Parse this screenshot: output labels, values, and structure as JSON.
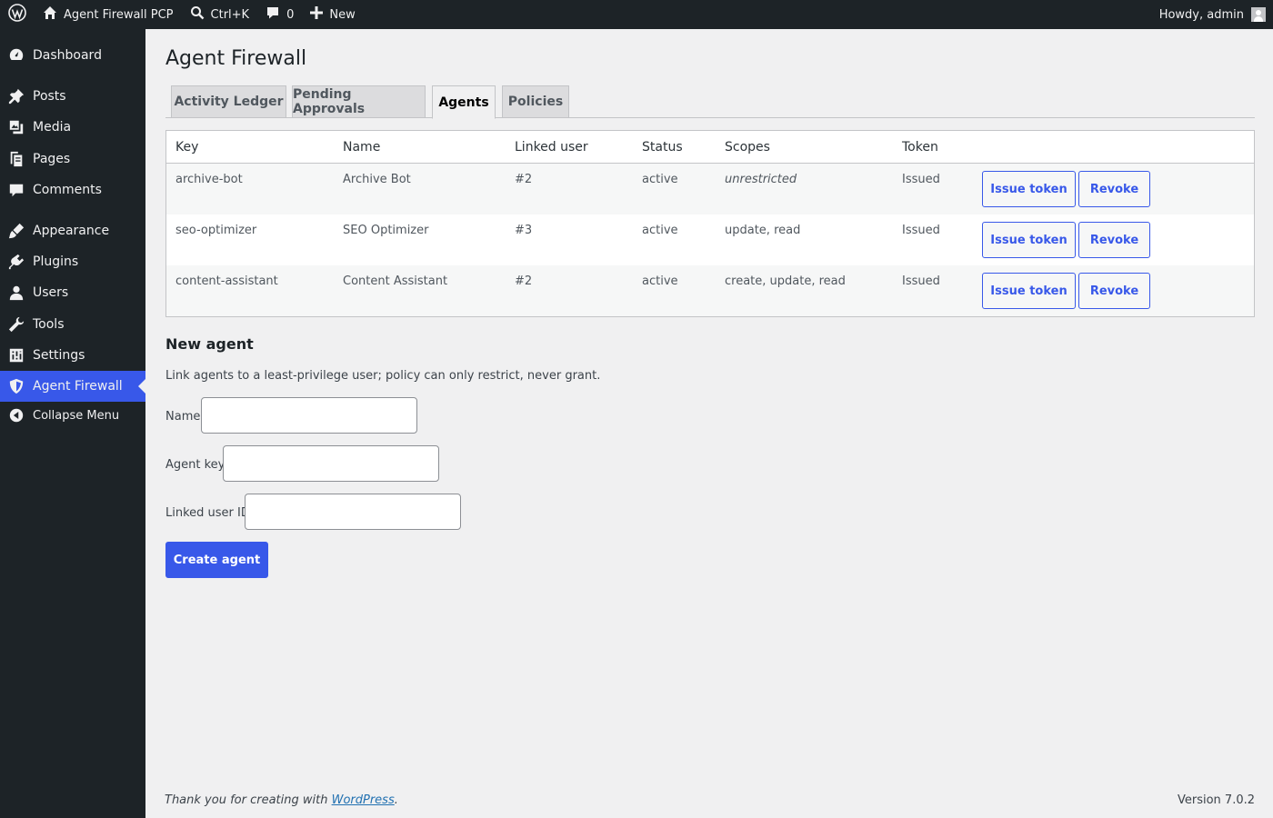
{
  "adminbar": {
    "site_name": "Agent Firewall PCP",
    "search_shortcut": "Ctrl+K",
    "comments_count": "0",
    "new_label": "New",
    "howdy": "Howdy, admin"
  },
  "sidebar": {
    "items": [
      {
        "label": "Dashboard",
        "icon": "dashboard-icon"
      },
      {
        "label": "Posts",
        "icon": "pin-icon"
      },
      {
        "label": "Media",
        "icon": "media-icon"
      },
      {
        "label": "Pages",
        "icon": "pages-icon"
      },
      {
        "label": "Comments",
        "icon": "comment-icon"
      },
      {
        "label": "Appearance",
        "icon": "brush-icon"
      },
      {
        "label": "Plugins",
        "icon": "plugin-icon"
      },
      {
        "label": "Users",
        "icon": "user-icon"
      },
      {
        "label": "Tools",
        "icon": "wrench-icon"
      },
      {
        "label": "Settings",
        "icon": "settings-icon"
      },
      {
        "label": "Agent Firewall",
        "icon": "shield-icon"
      }
    ],
    "collapse_label": "Collapse Menu"
  },
  "page": {
    "title": "Agent Firewall",
    "tabs": [
      "Activity Ledger",
      "Pending Approvals",
      "Agents",
      "Policies"
    ],
    "active_tab": "Agents"
  },
  "table": {
    "headers": [
      "Key",
      "Name",
      "Linked user",
      "Status",
      "Scopes",
      "Token"
    ],
    "rows": [
      {
        "key": "archive-bot",
        "name": "Archive Bot",
        "linked_user": "#2",
        "status": "active",
        "scopes": "unrestricted",
        "token": "Issued"
      },
      {
        "key": "seo-optimizer",
        "name": "SEO Optimizer",
        "linked_user": "#3",
        "status": "active",
        "scopes": "update, read",
        "token": "Issued"
      },
      {
        "key": "content-assistant",
        "name": "Content Assistant",
        "linked_user": "#2",
        "status": "active",
        "scopes": "create, update, read",
        "token": "Issued"
      }
    ],
    "issue_label": "Issue token",
    "revoke_label": "Revoke"
  },
  "new_agent": {
    "title": "New agent",
    "description": "Link agents to a least-privilege user; policy can only restrict, never grant.",
    "name_label": "Name",
    "name_value": "",
    "key_label": "Agent key",
    "key_value": "",
    "user_label": "Linked user ID",
    "user_value": "",
    "submit_label": "Create agent"
  },
  "footer": {
    "thanks_prefix": "Thank you for creating with",
    "link_text": "WordPress",
    "thanks_suffix": ".",
    "version": "Version 7.0.2"
  },
  "colors": {
    "accent": "#3858e9",
    "adminbar_bg": "#1d2327",
    "page_bg": "#f0f0f1"
  }
}
